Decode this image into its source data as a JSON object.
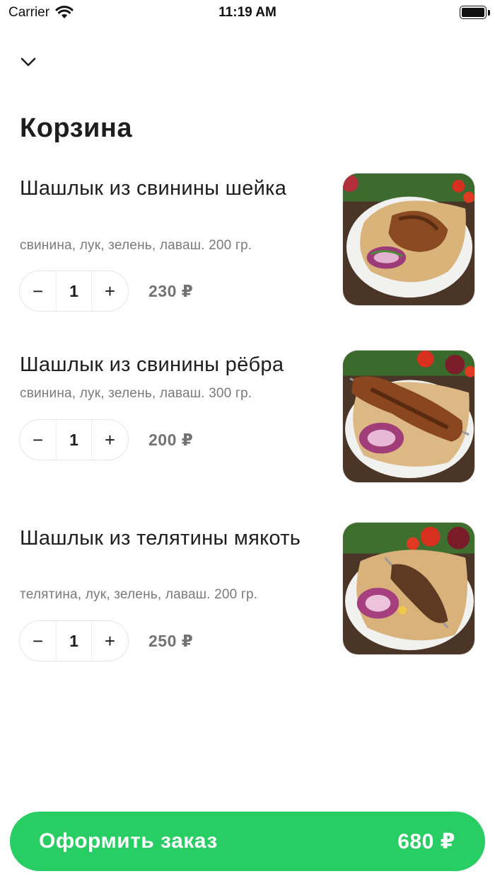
{
  "status_bar": {
    "carrier": "Carrier",
    "time": "11:19 AM"
  },
  "page": {
    "title": "Корзина"
  },
  "cart": {
    "items": [
      {
        "name": "Шашлык из свинины шейка",
        "description": "свинина, лук, зелень, лаваш. 200 гр.",
        "quantity": "1",
        "price": "230 ₽",
        "decrement": "−",
        "increment": "+",
        "image_icon": "pork-neck-skewer-photo"
      },
      {
        "name": "Шашлык из свинины рёбра",
        "description": "свинина, лук, зелень, лаваш. 300 гр.",
        "quantity": "1",
        "price": "200 ₽",
        "decrement": "−",
        "increment": "+",
        "image_icon": "pork-ribs-skewer-photo"
      },
      {
        "name": "Шашлык из телятины мякоть",
        "description": "телятина, лук, зелень, лаваш. 200 гр.",
        "quantity": "1",
        "price": "250 ₽",
        "decrement": "−",
        "increment": "+",
        "image_icon": "veal-skewer-photo"
      }
    ]
  },
  "checkout": {
    "label": "Оформить заказ",
    "total": "680 ₽"
  },
  "colors": {
    "accent": "#28cd64",
    "text": "#1e1e1e",
    "muted": "#7a7a7a",
    "price": "#737373"
  }
}
